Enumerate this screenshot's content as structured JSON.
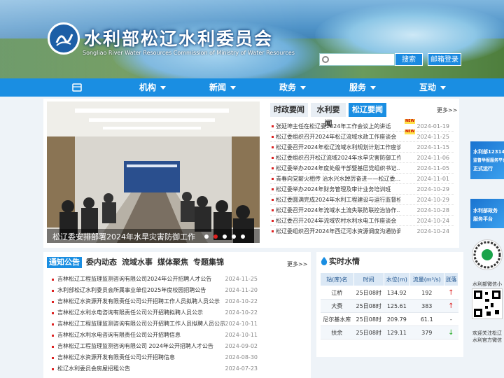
{
  "header": {
    "title": "水利部松辽水利委员会",
    "subtitle": "Songliao River Water Resources Commission of Ministry of Water Resources",
    "search_button": "搜索",
    "mail_button": "邮箱登录"
  },
  "nav": {
    "items": [
      {
        "label": "机构"
      },
      {
        "label": "新闻"
      },
      {
        "label": "政务"
      },
      {
        "label": "服务"
      },
      {
        "label": "互动"
      }
    ]
  },
  "slide": {
    "caption": "松辽委安排部署2024年水旱灾害防御工作",
    "slides_count": 5,
    "active_index": 1
  },
  "news": {
    "tabs": [
      "时政要闻",
      "水利要闻",
      "松辽要闻"
    ],
    "active_tab": 2,
    "more": "更多>>",
    "new_badge": "NEW",
    "items": [
      {
        "title": "张延坤主任在松辽委2024年工作会议上的讲话",
        "date": "2024-01-19",
        "new": true
      },
      {
        "title": "松辽委组织召开2024年松辽流域水政工作座谈会",
        "date": "2024-11-25",
        "new": true
      },
      {
        "title": "松辽委召开2024年松辽流域水利规划计划工作座谈会",
        "date": "2024-11-15",
        "new": false
      },
      {
        "title": "松辽委组织召开松辽流域2024年水旱灾害防御工作...",
        "date": "2024-11-06",
        "new": false
      },
      {
        "title": "松辽委举办2024年度处级干部暨基层党组织书记...",
        "date": "2024-11-05",
        "new": false
      },
      {
        "title": "青春向党薪火相传 治水兴水踔厉奋进——松辽委...",
        "date": "2024-11-01",
        "new": false
      },
      {
        "title": "松辽委举办2024年财务管理及审计业务培训班",
        "date": "2024-10-29",
        "new": false
      },
      {
        "title": "松辽委圆满完成2024年水利工程建设与运行监督检...",
        "date": "2024-10-29",
        "new": false
      },
      {
        "title": "松辽委召开2024年流域水土流失联防联控治协作...",
        "date": "2024-10-28",
        "new": false
      },
      {
        "title": "松辽委召开2024年流域农村水利水电工作座谈会",
        "date": "2024-10-24",
        "new": false
      },
      {
        "title": "松辽委组织召开2024年西辽河水资源调度沟通协调...",
        "date": "2024-10-24",
        "new": false
      }
    ]
  },
  "notices": {
    "tabs": [
      "通知公告",
      "委内动态",
      "流域水事",
      "媒体聚焦",
      "专题集锦"
    ],
    "active_tab": 0,
    "more": "更多>>",
    "items": [
      {
        "title": "吉林松辽工程监理监测咨询有限公司2024年公开招聘人才公告",
        "date": "2024-11-25"
      },
      {
        "title": "水利部松辽水利委员会所属事业单位2025年度校园招聘公告",
        "date": "2024-11-20"
      },
      {
        "title": "吉林松辽水资源开发有限责任公司公开招聘工作人员拟聘人员公示",
        "date": "2024-10-22"
      },
      {
        "title": "吉林松辽水利水电咨询有限责任公司公开招聘拟聘人员公示",
        "date": "2024-10-22"
      },
      {
        "title": "吉林松辽工程监理监测咨询有限公司公开招聘工作人员拟聘人员公示",
        "date": "2024-10-11"
      },
      {
        "title": "吉林松辽水利水电咨询有限责任公司公开招聘信息",
        "date": "2024-10-11"
      },
      {
        "title": "吉林松辽工程监理监测咨询有限公司 2024年公开招聘人才公告",
        "date": "2024-09-02"
      },
      {
        "title": "吉林松辽水资源开发有限责任公司公开招聘信息",
        "date": "2024-08-30"
      },
      {
        "title": "松辽水利委员会房屋招租公告",
        "date": "2024-07-23"
      }
    ]
  },
  "water": {
    "title": "实时水情",
    "headers": [
      "站(库)名",
      "时间",
      "水位(m)",
      "流量(m³/s)",
      "涨落"
    ],
    "rows": [
      {
        "station": "江桥",
        "time": "25日08时",
        "level": "134.92",
        "flow": "192",
        "trend": "up"
      },
      {
        "station": "大赉",
        "time": "25日08时",
        "level": "125.61",
        "flow": "383",
        "trend": "up"
      },
      {
        "station": "尼尔基水库",
        "time": "25日08时",
        "level": "209.79",
        "flow": "61.1",
        "trend": "flat"
      },
      {
        "station": "扶余",
        "time": "25日08时",
        "level": "129.11",
        "flow": "379",
        "trend": "down"
      }
    ],
    "symbols": {
      "up": "↑",
      "down": "↓",
      "flat": "-"
    }
  },
  "side": {
    "ad1_line1": "水利部12314",
    "ad1_line2": "监督举报服务平台",
    "ad1_line3": "正式运行",
    "ad2_line1": "水利部政务",
    "ad2_line2": "服务平台",
    "qr1_label": "水利部微信小程",
    "qr2_label1": "欢迎关注松辽",
    "qr2_label2": "水利官方微信"
  },
  "colors": {
    "accent": "#1a8ee2",
    "banner": "#2f6f9e"
  }
}
